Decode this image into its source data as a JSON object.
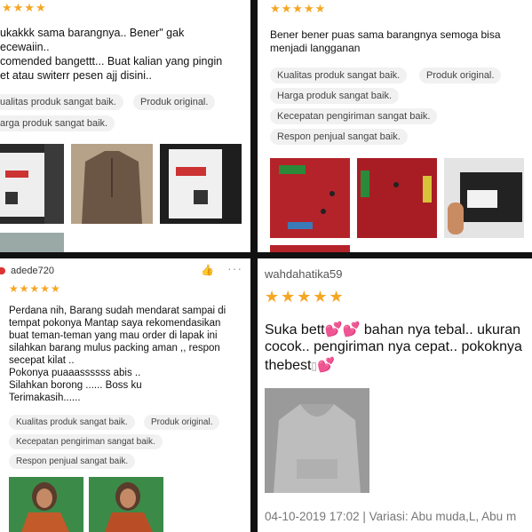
{
  "review1": {
    "stars": "★★★★",
    "lines": [
      "ukakkk sama barangnya.. Bener\" gak",
      "ecewaiin..",
      "comended bangettt... Buat kalian yang pingin",
      "et atau switerr pesen ajj disini.."
    ],
    "tags": [
      "ualitas produk sangat baik.",
      "Produk original.",
      "arga produk sangat baik."
    ]
  },
  "review2": {
    "stars": "★★★★★",
    "lines": [
      "Bener bener puas sama barangnya semoga bisa",
      "menjadi langganan"
    ],
    "tags": [
      "Kualitas produk sangat baik.",
      "Produk original.",
      "Harga produk sangat baik.",
      "Kecepatan pengiriman sangat baik.",
      "Respon penjual sangat baik."
    ]
  },
  "review3": {
    "username": "adede720",
    "stars": "★★★★★",
    "lines": [
      "Perdana nih, Barang sudah mendarat sampai di",
      "tempat pokonya Mantap saya rekomendasikan",
      "buat teman-teman yang mau order di lapak ini",
      "silahkan barang mulus packing aman ,, respon",
      "secepat kilat ..",
      "Pokonya puaaassssss abis ..",
      "Silahkan  borong ...... Boss ku",
      "Terimakasih......"
    ],
    "tags": [
      "Kualitas produk sangat baik.",
      "Produk original.",
      "Kecepatan pengiriman sangat baik.",
      "Respon penjual sangat baik."
    ]
  },
  "review4": {
    "username": "wahdahatika59",
    "stars": "★★★★★",
    "line1a": "Suka bett",
    "line1b": " bahan nya tebal.. ukuran",
    "line2": "cocok.. pengiriman nya cepat.. pokoknya",
    "line3": "thebest",
    "meta": "04-10-2019 17:02 | Variasi: Abu muda,L, Abu m"
  },
  "colors": {
    "star": "#f5a623",
    "heart": "#e0206a"
  }
}
